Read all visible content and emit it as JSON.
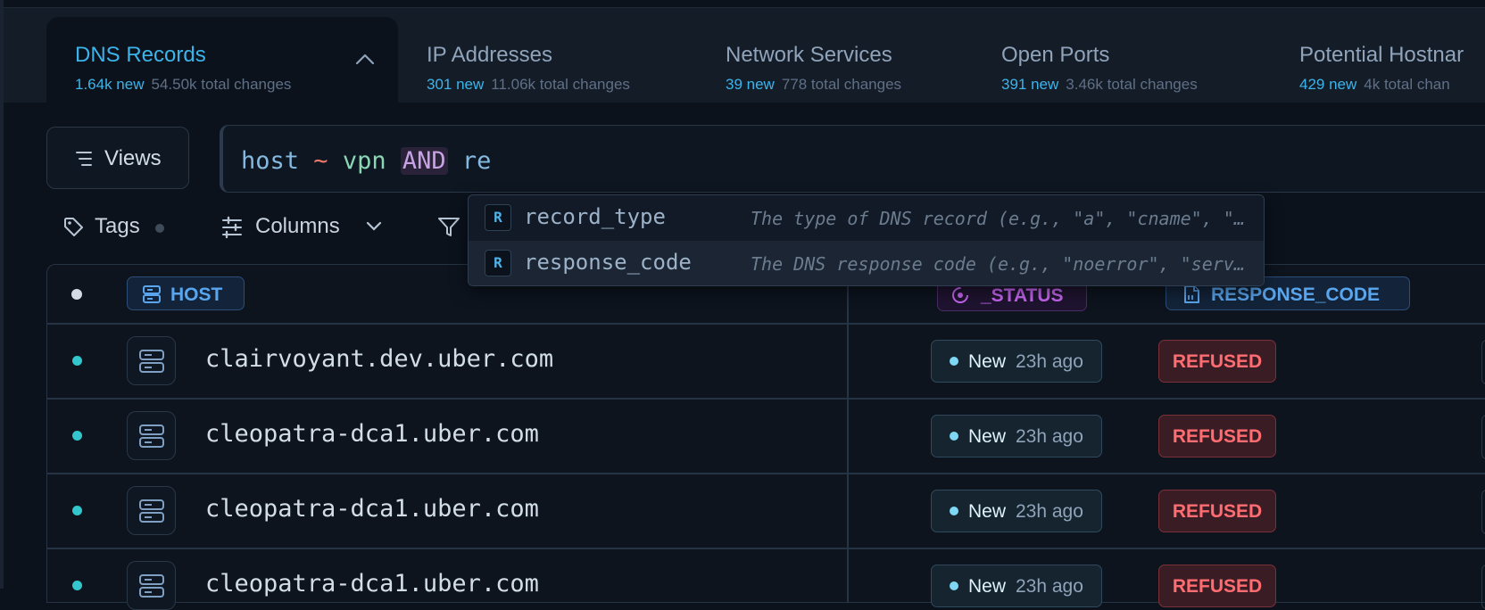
{
  "tabs": [
    {
      "title": "DNS Records",
      "new": "1.64k new",
      "total": "54.50k total changes",
      "active": true
    },
    {
      "title": "IP Addresses",
      "new": "301 new",
      "total": "11.06k total changes"
    },
    {
      "title": "Network Services",
      "new": "39 new",
      "total": "778 total changes"
    },
    {
      "title": "Open Ports",
      "new": "391 new",
      "total": "3.46k total changes"
    },
    {
      "title": "Potential Hostnar",
      "new": "429 new",
      "total": "4k total chan"
    }
  ],
  "toolbar": {
    "views_label": "Views",
    "tags_label": "Tags",
    "columns_label": "Columns"
  },
  "query": {
    "field": "host",
    "op": "~",
    "value": "vpn",
    "keyword": "AND",
    "typed": "re"
  },
  "autocomplete": [
    {
      "badge": "R",
      "name": "record_type",
      "desc": "The type of DNS record (e.g., \"a\", \"cname\", \"mx\", \"txt\")"
    },
    {
      "badge": "R",
      "name": "response_code",
      "desc": "The DNS response code (e.g., \"noerror\", \"servfail\", \"refused\")"
    }
  ],
  "table": {
    "headers": {
      "host": "HOST",
      "status": "_STATUS",
      "response_code": "RESPONSE_CODE"
    },
    "rows": [
      {
        "host": "clairvoyant.dev.uber.com",
        "status": "New",
        "age": "23h ago",
        "response": "REFUSED"
      },
      {
        "host": "cleopatra-dca1.uber.com",
        "status": "New",
        "age": "23h ago",
        "response": "REFUSED"
      },
      {
        "host": "cleopatra-dca1.uber.com",
        "status": "New",
        "age": "23h ago",
        "response": "REFUSED"
      },
      {
        "host": "cleopatra-dca1.uber.com",
        "status": "New",
        "age": "23h ago",
        "response": "REFUSED"
      }
    ]
  },
  "colors": {
    "accent": "#3cb4ea",
    "refused": "#ff6d72",
    "status": "#c566f0",
    "background": "#0b121c"
  }
}
